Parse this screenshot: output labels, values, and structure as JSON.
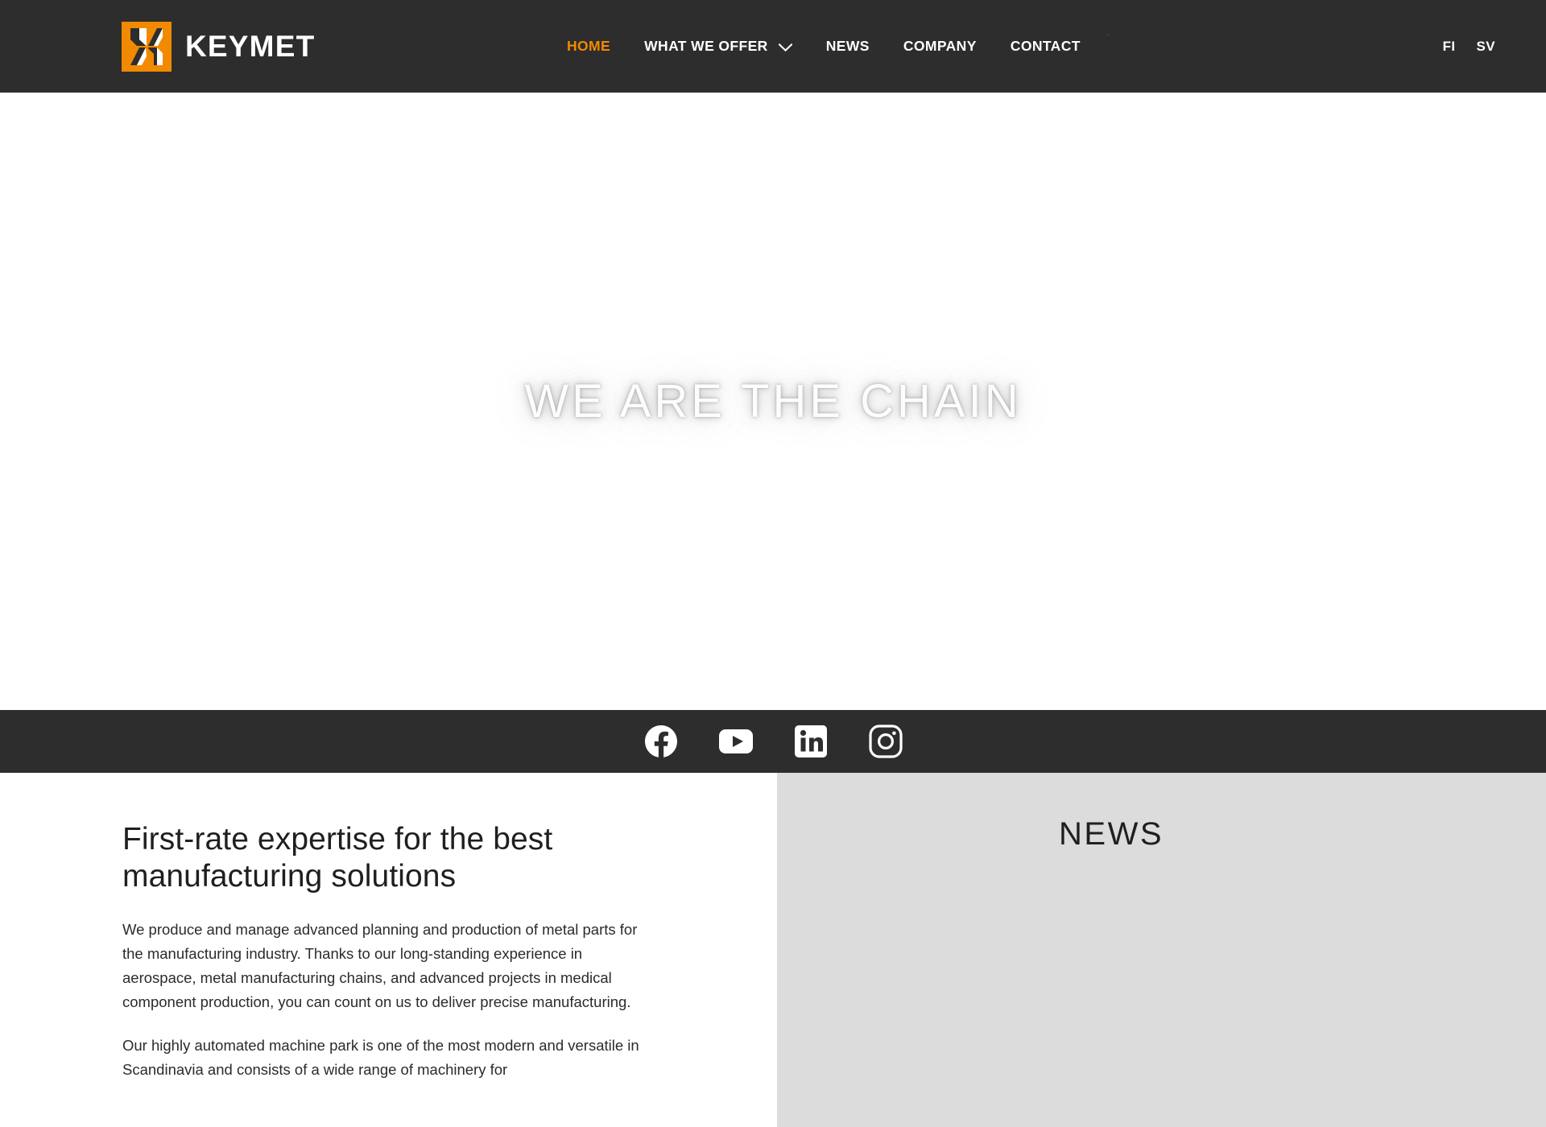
{
  "site": {
    "brand_name": "KEYMET",
    "accent_color": "#F18A00",
    "header_bg": "#2d2d2d",
    "panel_bg": "#dcdcdc"
  },
  "header": {
    "logo_icon": "keymet-k-logo-icon",
    "nav": [
      {
        "label": "HOME",
        "active": true,
        "has_dropdown": false
      },
      {
        "label": "WHAT WE OFFER",
        "active": false,
        "has_dropdown": true,
        "dropdown_icon": "chevron-down-icon"
      },
      {
        "label": "NEWS",
        "active": false,
        "has_dropdown": false
      },
      {
        "label": "COMPANY",
        "active": false,
        "has_dropdown": false
      },
      {
        "label": "CONTACT",
        "active": false,
        "has_dropdown": false
      }
    ],
    "languages": [
      {
        "label": "FI"
      },
      {
        "label": "SV"
      }
    ]
  },
  "hero": {
    "title": "WE ARE THE CHAIN"
  },
  "social": {
    "links": [
      {
        "name": "facebook",
        "icon": "facebook-icon"
      },
      {
        "name": "youtube",
        "icon": "youtube-icon"
      },
      {
        "name": "linkedin",
        "icon": "linkedin-icon"
      },
      {
        "name": "instagram",
        "icon": "instagram-icon"
      }
    ]
  },
  "main": {
    "heading": "First-rate expertise for the best manufacturing solutions",
    "paragraphs": [
      "We produce and manage advanced planning and production of metal parts for the manufacturing industry. Thanks to our long-standing experience in aerospace, metal manufacturing chains, and advanced projects in medical component production, you can count on us to deliver precise manufacturing.",
      "Our highly automated machine park is one of the most modern and versatile in Scandinavia and consists of a wide range of machinery for"
    ],
    "news_heading": "NEWS"
  }
}
